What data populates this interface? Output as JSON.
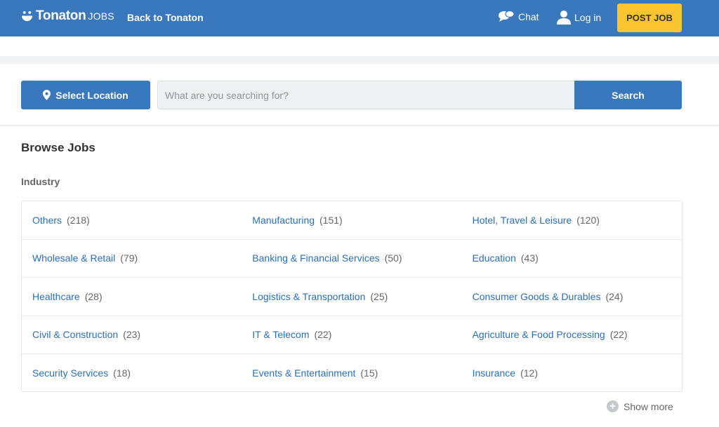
{
  "header": {
    "logo_name": "Tonaton",
    "logo_sub": "JOBS",
    "back_label": "Back to Tonaton",
    "chat_label": "Chat",
    "login_label": "Log in",
    "post_job_label": "POST JOB"
  },
  "search": {
    "location_label": "Select Location",
    "placeholder": "What are you searching for?",
    "button_label": "Search"
  },
  "browse": {
    "title": "Browse Jobs",
    "section_label": "Industry",
    "industries": [
      {
        "name": "Others",
        "count": "(218)"
      },
      {
        "name": "Manufacturing",
        "count": "(151)"
      },
      {
        "name": "Hotel, Travel & Leisure",
        "count": "(120)"
      },
      {
        "name": "Wholesale & Retail",
        "count": "(79)"
      },
      {
        "name": "Banking & Financial Services",
        "count": "(50)"
      },
      {
        "name": "Education",
        "count": "(43)"
      },
      {
        "name": "Healthcare",
        "count": "(28)"
      },
      {
        "name": "Logistics & Transportation",
        "count": "(25)"
      },
      {
        "name": "Consumer Goods & Durables",
        "count": "(24)"
      },
      {
        "name": "Civil & Construction",
        "count": "(23)"
      },
      {
        "name": "IT & Telecom",
        "count": "(22)"
      },
      {
        "name": "Agriculture & Food Processing",
        "count": "(22)"
      },
      {
        "name": "Security Services",
        "count": "(18)"
      },
      {
        "name": "Events & Entertainment",
        "count": "(15)"
      },
      {
        "name": "Insurance",
        "count": "(12)"
      }
    ],
    "show_more_label": "Show more"
  },
  "colors": {
    "brand_blue": "#3a78be",
    "post_job_yellow": "#fbc531",
    "link_blue": "#2a6fb6"
  }
}
